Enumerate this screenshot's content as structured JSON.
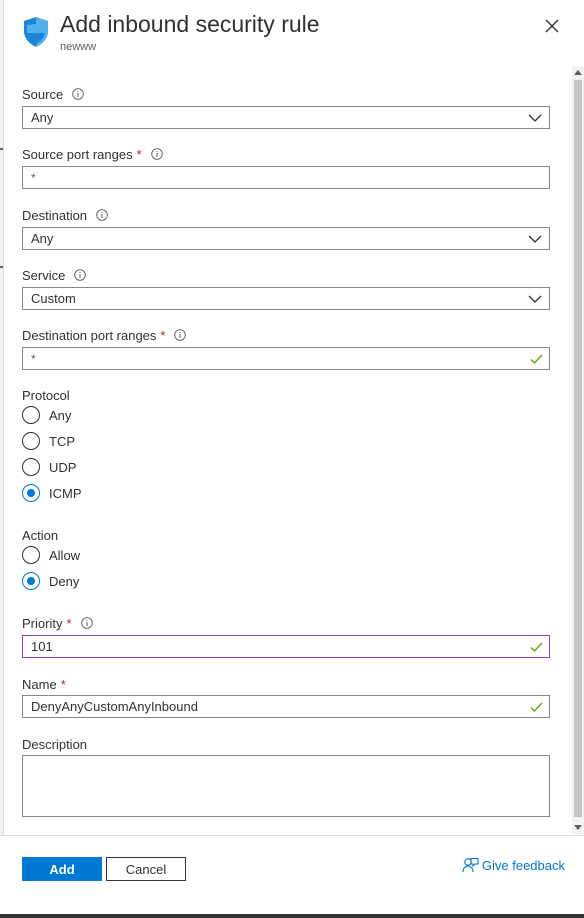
{
  "panel": {
    "title": "Add inbound security rule",
    "subtitle": "newww"
  },
  "form": {
    "source": {
      "label": "Source",
      "value": "Any"
    },
    "source_port_ranges": {
      "label": "Source port ranges",
      "required": "*",
      "value": "*"
    },
    "destination": {
      "label": "Destination",
      "value": "Any"
    },
    "service": {
      "label": "Service",
      "value": "Custom"
    },
    "destination_port_ranges": {
      "label": "Destination port ranges",
      "required": "*",
      "value": "*",
      "valid": true
    },
    "protocol": {
      "label": "Protocol",
      "options": [
        "Any",
        "TCP",
        "UDP",
        "ICMP"
      ],
      "selected": "ICMP"
    },
    "action": {
      "label": "Action",
      "options": [
        "Allow",
        "Deny"
      ],
      "selected": "Deny"
    },
    "priority": {
      "label": "Priority",
      "required": "*",
      "value": "101",
      "valid": true
    },
    "name": {
      "label": "Name",
      "required": "*",
      "value": "DenyAnyCustomAnyInbound",
      "valid": true
    },
    "description": {
      "label": "Description",
      "value": ""
    }
  },
  "footer": {
    "add_label": "Add",
    "cancel_label": "Cancel",
    "feedback_label": "Give feedback"
  },
  "icons": {
    "shield": "shield-icon",
    "close": "close-icon",
    "info": "info-icon",
    "chevron": "chevron-down-icon",
    "check": "checkmark-icon",
    "feedback": "feedback-icon"
  },
  "colors": {
    "accent": "#0078d4",
    "required": "#a4262c",
    "valid_check": "#57a300",
    "focus_border": "#8e44ad"
  }
}
